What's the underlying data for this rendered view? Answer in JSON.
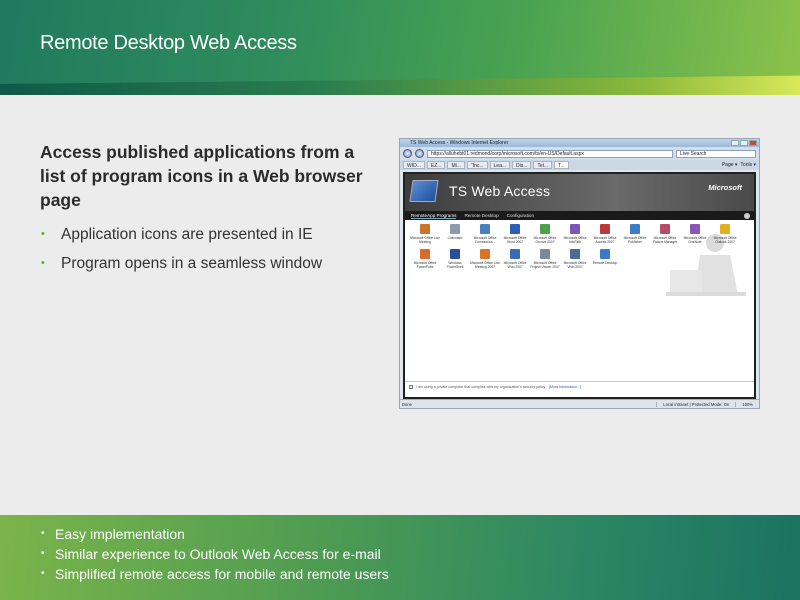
{
  "slide": {
    "title": "Remote Desktop Web Access",
    "heading": "Access published applications from a list of program icons in a Web browser page",
    "bullets": [
      "Application icons are presented in IE",
      "Program opens in a seamless window"
    ],
    "footer_bullets": [
      "Easy implementation",
      "Similar experience to Outlook Web Access for e-mail",
      "Simplified remote access for mobile and remote users"
    ],
    "bullet_glyph": "•"
  },
  "browser": {
    "window_title": "TS Web Access - Windows Internet Explorer",
    "url": "https://alluhebt01.redmond/corp/microsoft.com/ts/en-US/Default.aspx",
    "search_placeholder": "Live Search",
    "tabs": [
      "WID...",
      "EZ...",
      "Mi...",
      "\"Inc...",
      "Lea...",
      "Dis...",
      "Tel...",
      "T..."
    ],
    "tools": [
      "Page ▾",
      "Tools ▾"
    ],
    "status_text": "Done",
    "status_zone": "Local intranet | Protected Mode: On",
    "status_zoom": "100%"
  },
  "tswa": {
    "title": "TS Web Access",
    "brand": "Microsoft",
    "nav": [
      "RemoteApp Programs",
      "Remote Desktop",
      "Configuration"
    ],
    "apps_row1": [
      {
        "label": "Microsoft Office Live Meeting",
        "color": "#c8742a"
      },
      {
        "label": "Calculator",
        "color": "#8a9bb0"
      },
      {
        "label": "Microsoft Office Communica...",
        "color": "#4a7fc1"
      },
      {
        "label": "Microsoft Office Word 2007",
        "color": "#2b5fb3"
      },
      {
        "label": "Microsoft Office Groove 2007",
        "color": "#4aa24a"
      },
      {
        "label": "Microsoft Office InfoPath",
        "color": "#7a58b8"
      },
      {
        "label": "Microsoft Office Access 2007",
        "color": "#b83a3a"
      },
      {
        "label": "Microsoft Office Publisher",
        "color": "#3c7cc8"
      },
      {
        "label": "Microsoft Office Picture Manager",
        "color": "#b84a6a"
      },
      {
        "label": "Microsoft Office OneNote",
        "color": "#8a56b8"
      },
      {
        "label": "Microsoft Office Outlook 2007",
        "color": "#e0b020"
      }
    ],
    "apps_row2": [
      {
        "label": "Microsoft Office PowerPoint",
        "color": "#d86a2a"
      },
      {
        "label": "Windows PowerShell",
        "color": "#2a4e9a"
      },
      {
        "label": "Microsoft Office Live Meeting 2007",
        "color": "#d8742a"
      },
      {
        "label": "Microsoft Office Visio 2007",
        "color": "#3a6ab8"
      },
      {
        "label": "Microsoft Office Project Viewer 2007",
        "color": "#7a8a9a"
      },
      {
        "label": "Microsoft Office Visio 2007",
        "color": "#4a6a9a"
      },
      {
        "label": "Remote Desktop",
        "color": "#3a7ac8"
      }
    ],
    "footer_text": "I am using a private computer that complies with my organization's security policy.",
    "footer_link": "[More information...]"
  }
}
